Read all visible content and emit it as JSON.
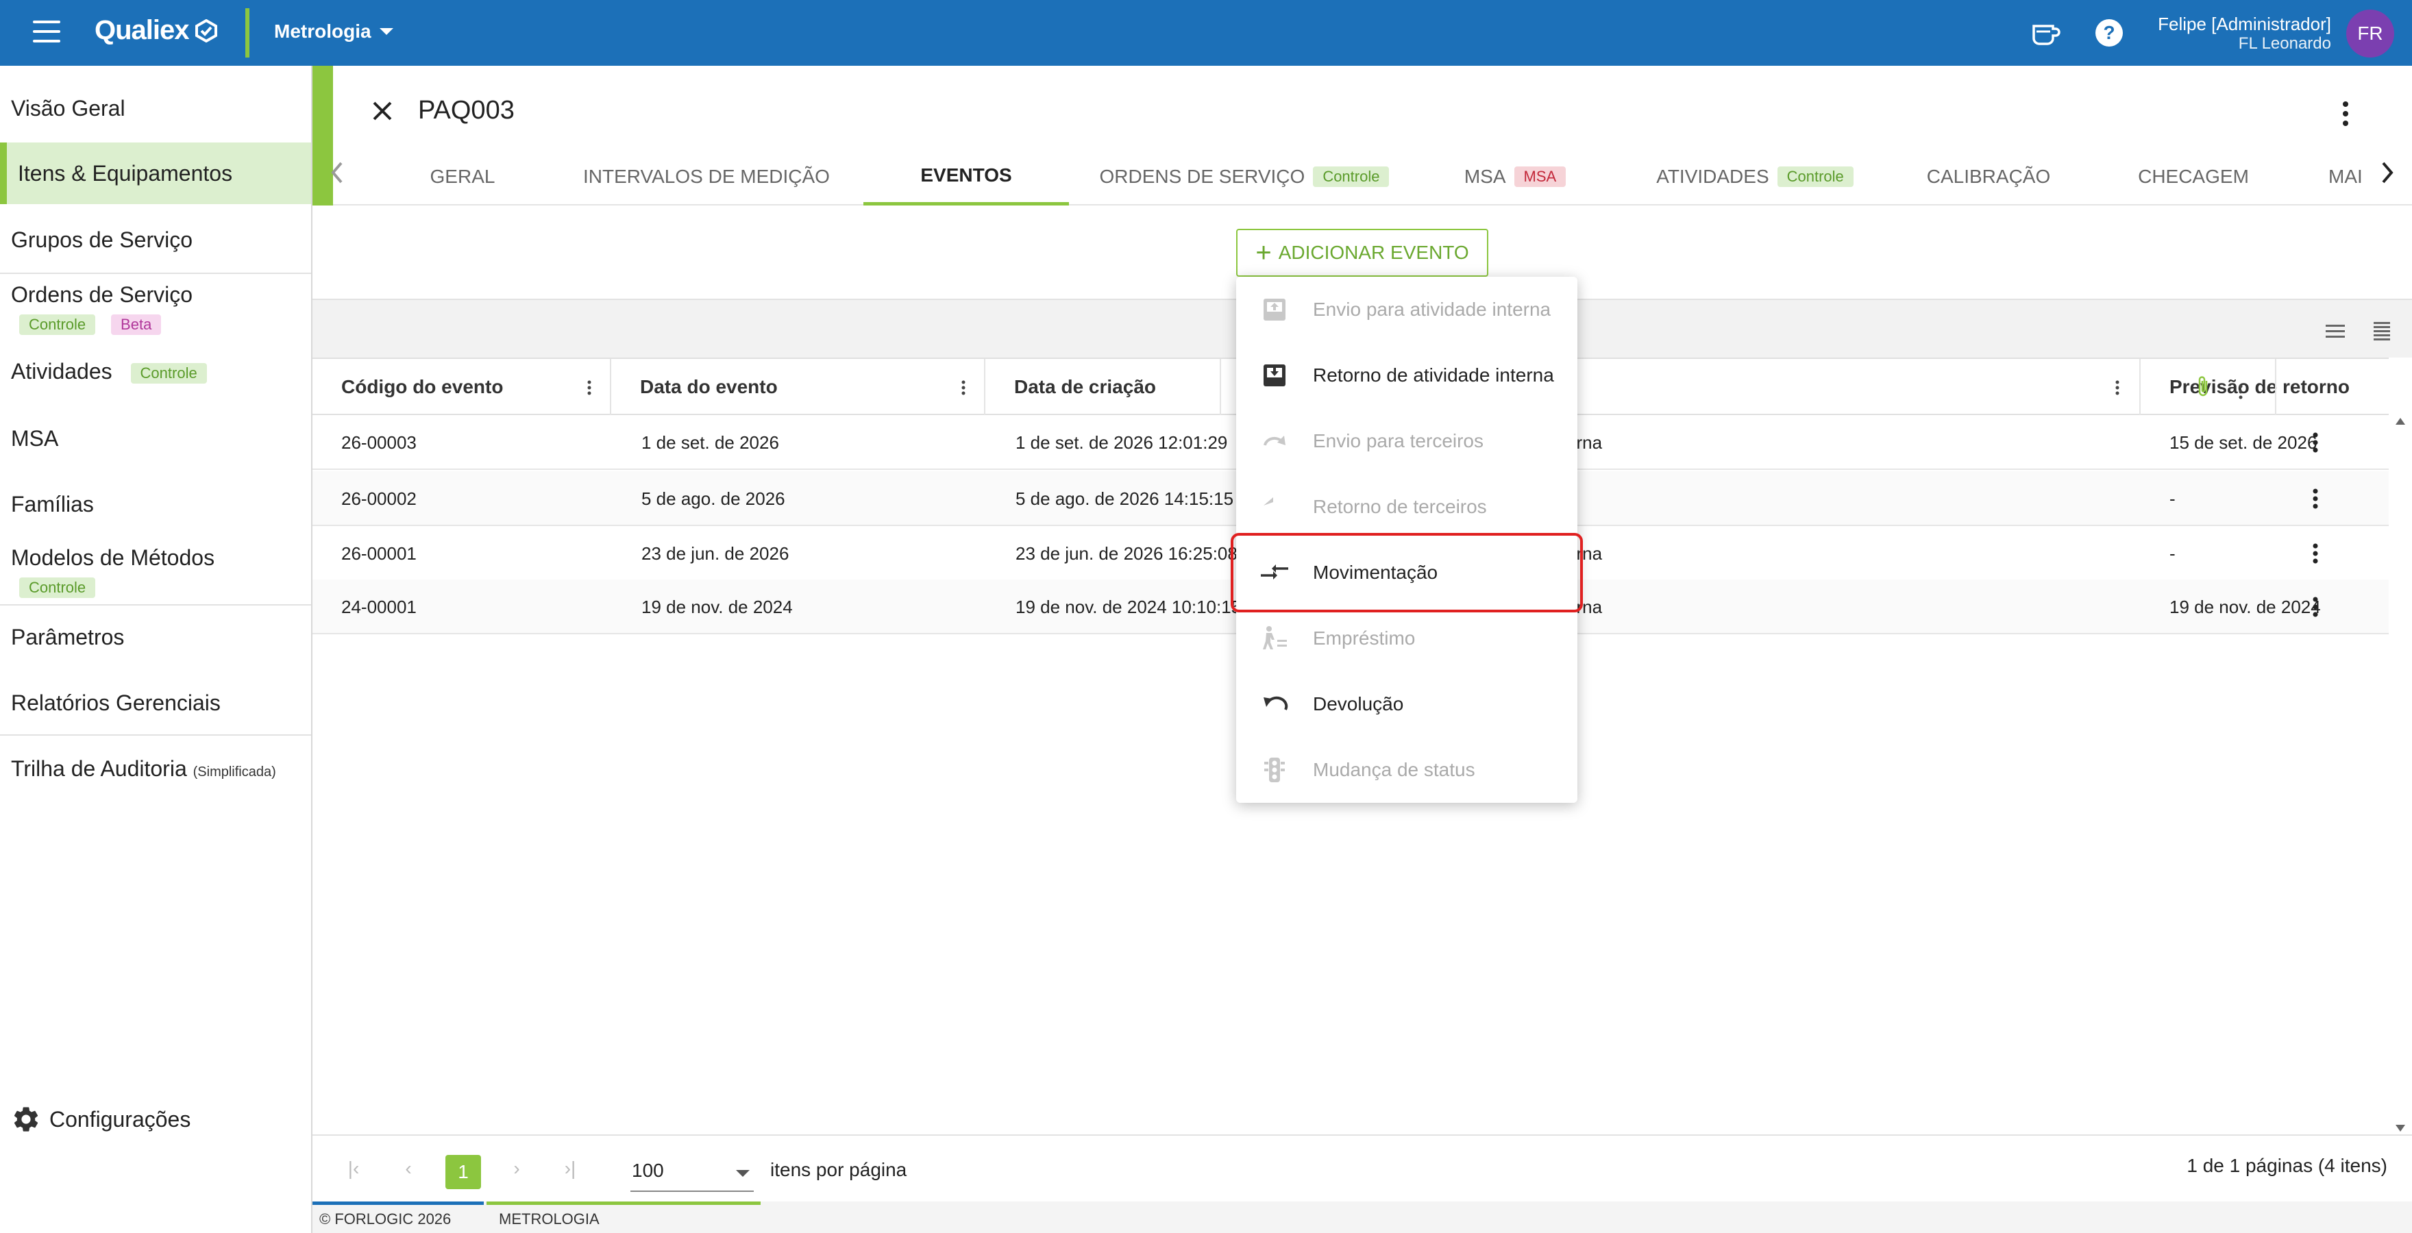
{
  "topbar": {
    "app_name": "Qualiex",
    "module": "Metrologia",
    "user_name": "Felipe [Administrador]",
    "user_org": "FL Leonardo",
    "avatar_initials": "FR",
    "bar_color": "#1c70b8",
    "accent_color": "#8cc63f"
  },
  "sidebar": {
    "items": [
      {
        "label": "Visão Geral"
      },
      {
        "label": "Itens & Equipamentos"
      },
      {
        "label": "Grupos de Serviço"
      },
      {
        "label": "Ordens de Serviço",
        "badges": [
          "Controle",
          "Beta"
        ]
      },
      {
        "label": "Atividades",
        "badges": [
          "Controle"
        ]
      },
      {
        "label": "MSA"
      },
      {
        "label": "Famílias"
      },
      {
        "label": "Modelos de Métodos",
        "badges": [
          "Controle"
        ]
      },
      {
        "label": "Parâmetros"
      },
      {
        "label": "Relatórios Gerenciais"
      },
      {
        "label": "Trilha de Auditoria",
        "note": "(Simplificada)"
      }
    ],
    "settings_label": "Configurações"
  },
  "header": {
    "title": "PAQ003"
  },
  "tabs": [
    {
      "label": "GERAL"
    },
    {
      "label": "INTERVALOS DE MEDIÇÃO"
    },
    {
      "label": "EVENTOS"
    },
    {
      "label": "ORDENS DE SERVIÇO",
      "badge": "Controle"
    },
    {
      "label": "MSA",
      "badge": "MSA"
    },
    {
      "label": "ATIVIDADES",
      "badge": "Controle"
    },
    {
      "label": "CALIBRAÇÃO"
    },
    {
      "label": "CHECAGEM"
    },
    {
      "label": "MAI"
    }
  ],
  "add_event_label": "ADICIONAR EVENTO",
  "table": {
    "columns": [
      "Código do evento",
      "Data do evento",
      "Data de criação",
      "",
      "Previsão de retorno"
    ],
    "rows": [
      [
        "26-00003",
        "1 de set. de 2026",
        "1 de set. de 2026 12:01:29",
        "erna",
        "15 de set. de 2026"
      ],
      [
        "26-00002",
        "5 de ago. de 2026",
        "5 de ago. de 2026 14:15:15",
        "",
        "-"
      ],
      [
        "26-00001",
        "23 de jun. de 2026",
        "23 de jun. de 2026 16:25:08",
        "erna",
        "-"
      ],
      [
        "24-00001",
        "19 de nov. de 2024",
        "19 de nov. de 2024 10:10:15",
        "erna",
        "19 de nov. de 2024"
      ]
    ]
  },
  "menu": {
    "items": [
      {
        "label": "Envio para atividade interna",
        "icon": "inbox-out-icon",
        "enabled": false
      },
      {
        "label": "Retorno de atividade interna",
        "icon": "inbox-in-icon",
        "enabled": true
      },
      {
        "label": "Envio para terceiros",
        "icon": "redo-arrow-icon",
        "enabled": false
      },
      {
        "label": "Retorno de terceiros",
        "icon": "reply-icon",
        "enabled": false
      },
      {
        "label": "Movimentação",
        "icon": "swap-arrows-icon",
        "enabled": true
      },
      {
        "label": "Empréstimo",
        "icon": "person-loan-icon",
        "enabled": false
      },
      {
        "label": "Devolução",
        "icon": "undo-icon",
        "enabled": true
      },
      {
        "label": "Mudança de status",
        "icon": "traffic-light-icon",
        "enabled": false
      }
    ]
  },
  "pager": {
    "current_page": "1",
    "page_size": "100",
    "page_size_label": "itens por página",
    "summary": "1 de 1 páginas (4 itens)"
  },
  "footer": {
    "copyright": "© FORLOGIC 2026",
    "module": "METROLOGIA"
  }
}
